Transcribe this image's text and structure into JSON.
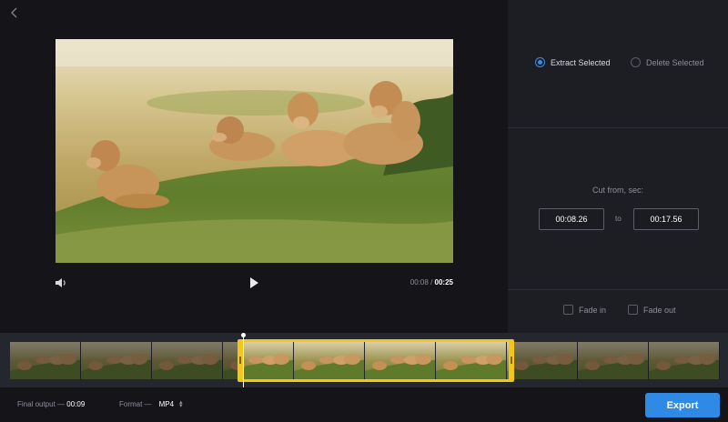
{
  "options": {
    "extract_label": "Extract Selected",
    "delete_label": "Delete Selected",
    "selected": "extract"
  },
  "cut": {
    "label": "Cut from, sec:",
    "from": "00:08.26",
    "to_word": "to",
    "to": "00:17.56"
  },
  "fade": {
    "fade_in_label": "Fade in",
    "fade_out_label": "Fade out",
    "fade_in_checked": false,
    "fade_out_checked": false
  },
  "player": {
    "current_time": "00:08",
    "separator": "/",
    "total_time": "00:25"
  },
  "footer": {
    "final_output_label": "Final output —",
    "final_output_value": "00:09",
    "format_label": "Format —",
    "format_value": "MP4",
    "export_label": "Export"
  },
  "colors": {
    "accent": "#2f8ae6",
    "selection": "#f5c518",
    "radio_active": "#3b8de0"
  },
  "icons": {
    "back": "chevron-left-icon",
    "volume": "speaker-icon",
    "play": "play-icon",
    "format_toggle": "updown-arrows-icon"
  }
}
